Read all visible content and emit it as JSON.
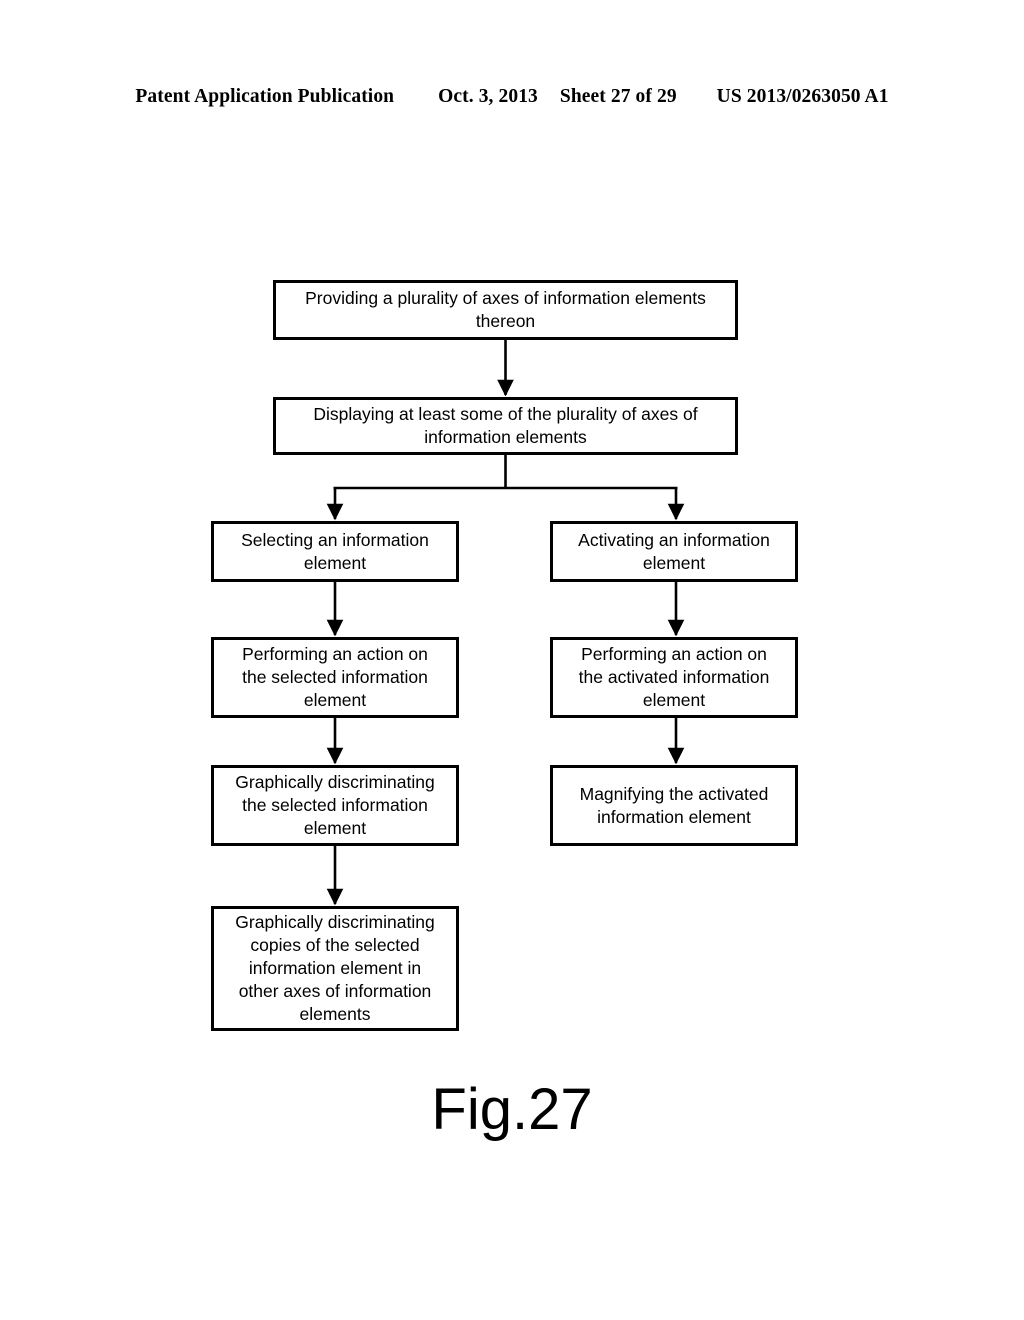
{
  "header": {
    "publication": "Patent Application Publication",
    "date": "Oct. 3, 2013",
    "sheet": "Sheet 27 of 29",
    "document_number": "US 2013/0263050 A1"
  },
  "figure": {
    "caption": "Fig.27",
    "ink_color": "#000000",
    "background_color": "#ffffff"
  },
  "flowchart": {
    "nodes": [
      {
        "id": "providing",
        "label": "Providing a plurality of axes of information elements\nthereon"
      },
      {
        "id": "displaying",
        "label": "Displaying at least some of the plurality of axes of\ninformation elements"
      },
      {
        "id": "selecting",
        "label": "Selecting an information\nelement"
      },
      {
        "id": "activating",
        "label": "Activating an information\nelement"
      },
      {
        "id": "perform_selected",
        "label": "Performing an action on\nthe selected information\nelement"
      },
      {
        "id": "perform_activated",
        "label": "Performing an action on\nthe activated information\nelement"
      },
      {
        "id": "discriminate_selected",
        "label": "Graphically discriminating\nthe selected information\nelement"
      },
      {
        "id": "magnifying",
        "label": "Magnifying the activated\ninformation element"
      },
      {
        "id": "discriminate_copies",
        "label": "Graphically discriminating\ncopies of the selected\ninformation element in\nother axes of information\nelements"
      }
    ],
    "edges": [
      {
        "from": "providing",
        "to": "displaying",
        "type": "straight-arrow"
      },
      {
        "from": "displaying",
        "to": "selecting",
        "type": "branch-arrow"
      },
      {
        "from": "displaying",
        "to": "activating",
        "type": "branch-arrow"
      },
      {
        "from": "selecting",
        "to": "perform_selected",
        "type": "straight-arrow"
      },
      {
        "from": "activating",
        "to": "perform_activated",
        "type": "straight-arrow"
      },
      {
        "from": "perform_selected",
        "to": "discriminate_selected",
        "type": "straight-arrow"
      },
      {
        "from": "perform_activated",
        "to": "magnifying",
        "type": "straight-arrow"
      },
      {
        "from": "discriminate_selected",
        "to": "discriminate_copies",
        "type": "straight-arrow"
      }
    ]
  }
}
